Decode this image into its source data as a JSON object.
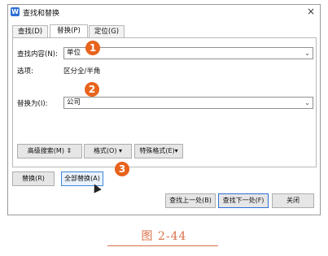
{
  "window": {
    "title": "查找和替换",
    "app_icon": "W",
    "close_glyph": "×"
  },
  "tabs": [
    {
      "label": "查找(D)"
    },
    {
      "label": "替换(P)",
      "active": true
    },
    {
      "label": "定位(G)"
    }
  ],
  "find": {
    "label": "查找内容(N):",
    "value": "单位",
    "dropdown_glyph": "⌄"
  },
  "options": {
    "label": "选项:",
    "value": "区分全/半角"
  },
  "replace": {
    "label": "替换为(I):",
    "value": "公司",
    "dropdown_glyph": "⌄"
  },
  "buttons": {
    "advanced_search": "高级搜索(M) ⇕",
    "format": "格式(O) ▾",
    "special_format": "特殊格式(E)▾",
    "replace": "替换(R)",
    "replace_all": "全部替换(A)",
    "find_prev": "查找上一处(B)",
    "find_next": "查找下一处(F)",
    "close": "关闭"
  },
  "markers": [
    "1",
    "2",
    "3"
  ],
  "caption": "图 2-44",
  "colors": {
    "marker": "#e8631c",
    "caption": "#d9714a",
    "accent": "#2f6fd6"
  }
}
